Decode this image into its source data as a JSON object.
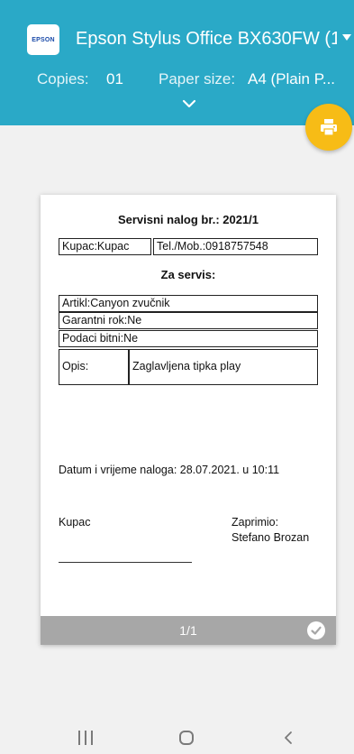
{
  "header": {
    "logo_text": "EPSON",
    "printer_name": "Epson Stylus Office BX630FW (1...",
    "copies_label": "Copies:",
    "copies_value": "01",
    "paper_size_label": "Paper size:",
    "paper_size_value": "A4 (Plain P..."
  },
  "document": {
    "title": "Servisni nalog br.: 2021/1",
    "customer": "Kupac:Kupac",
    "phone": "Tel./Mob.:0918757548",
    "section_title": "Za servis:",
    "article": "Artikl:Canyon zvučnik",
    "warranty": "Garantni rok:Ne",
    "important_data": "Podaci bitni:Ne",
    "description_label": "Opis:",
    "description_value": "Zaglavljena tipka play",
    "datetime": "Datum i vrijeme naloga: 28.07.2021. u 10:11",
    "customer_sign_label": "Kupac",
    "received_label": "Zaprimio:",
    "received_by": "Stefano Brozan"
  },
  "preview": {
    "page_count": "1/1"
  },
  "colors": {
    "header": "#2aa9c7",
    "fab": "#f7bc16",
    "page_bar": "#a7a7a7"
  }
}
